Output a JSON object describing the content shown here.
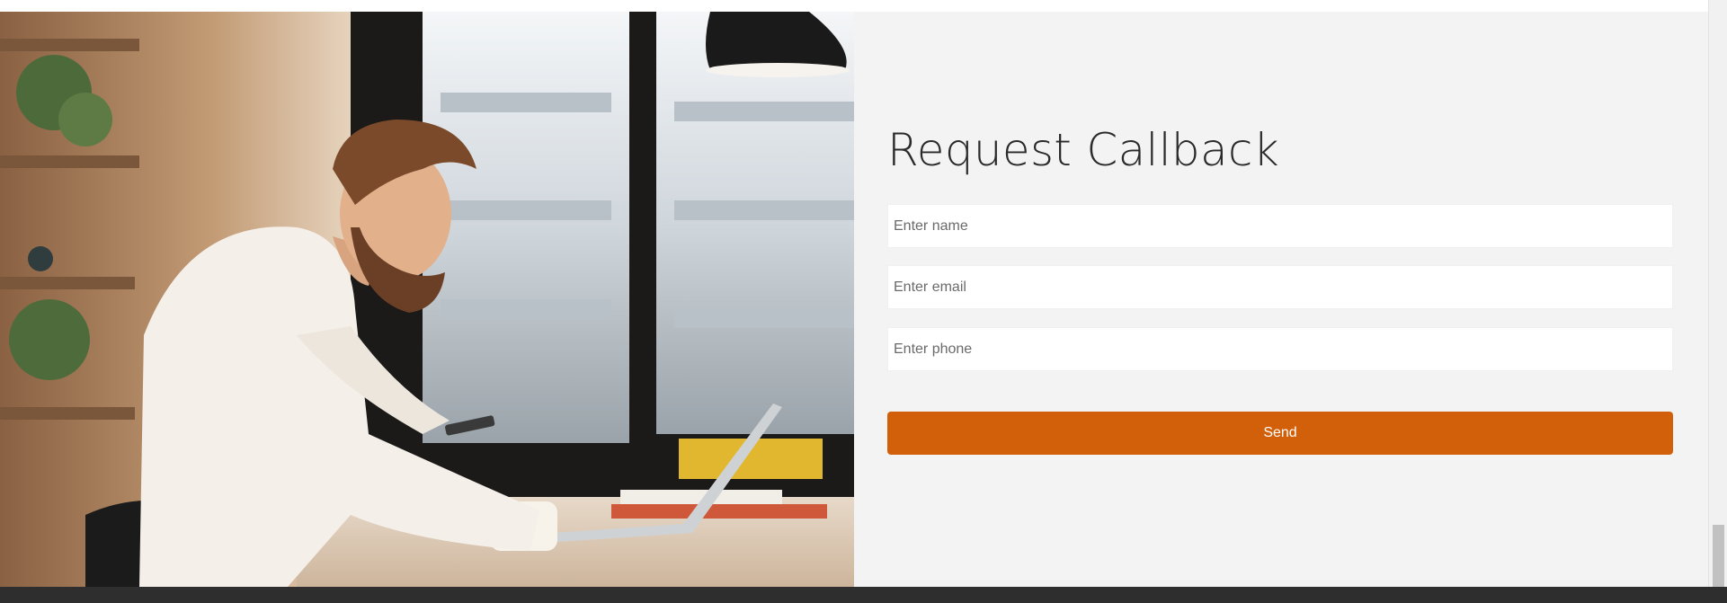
{
  "callback": {
    "title": "Request Callback",
    "name_placeholder": "Enter name",
    "email_placeholder": "Enter email",
    "phone_placeholder": "Enter phone",
    "send_label": "Send"
  },
  "colors": {
    "accent": "#d2600b",
    "form_background": "#f3f3f3",
    "footer": "#2e2e2e"
  },
  "photo": {
    "subject": "man-at-desk-with-phone-and-laptop"
  }
}
